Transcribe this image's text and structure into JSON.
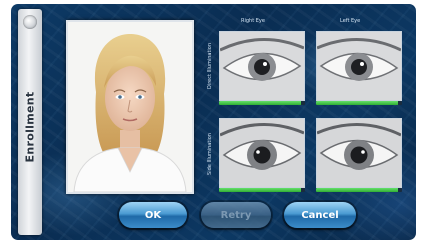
{
  "side_tab": {
    "label": "Enrollment"
  },
  "columns": {
    "right_eye": "Right Eye",
    "left_eye": "Left Eye"
  },
  "rows": {
    "first": "Direct Illumination",
    "second": "Side Illumination"
  },
  "quality": {
    "right_eye_direct": 0.95,
    "left_eye_direct": 0.95,
    "right_eye_side": 0.95,
    "left_eye_side": 0.95
  },
  "buttons": {
    "ok": "OK",
    "retry": "Retry",
    "cancel": "Cancel"
  },
  "colors": {
    "quality_good": "#3fc243",
    "button_accent": "#4a9ad2",
    "background": "#0a2d52"
  }
}
